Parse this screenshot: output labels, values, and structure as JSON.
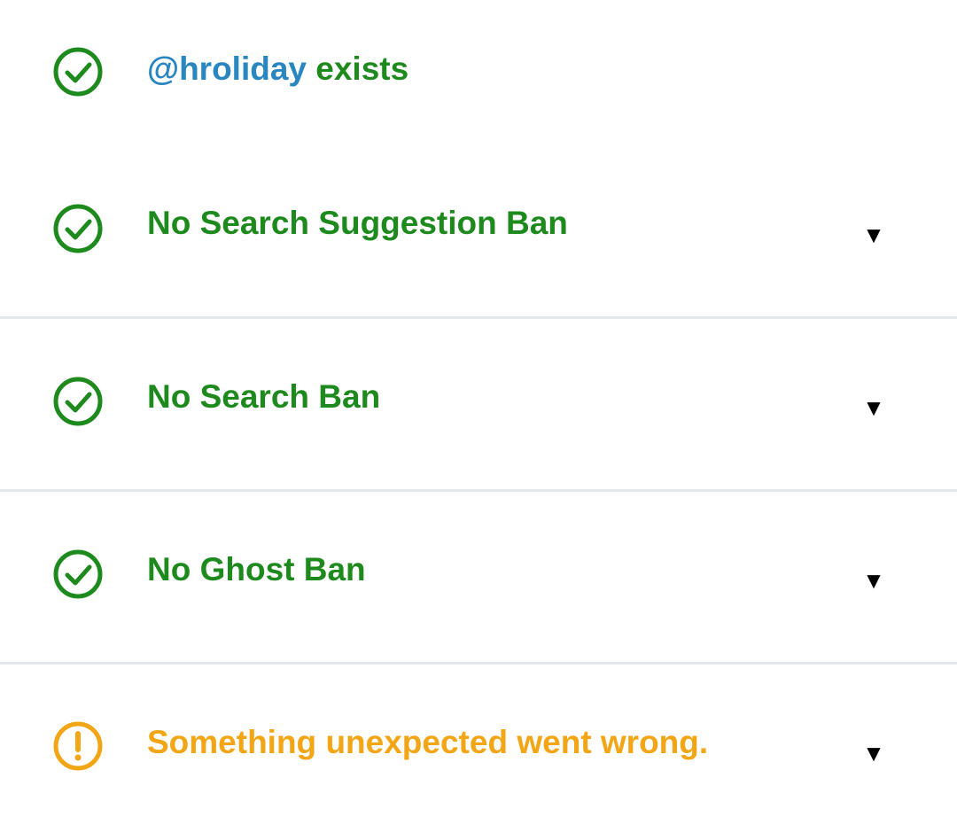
{
  "colors": {
    "success": "#1e8a1e",
    "warning": "#f2a515",
    "link": "#2a86bf",
    "divider": "#e3e7ea"
  },
  "results": [
    {
      "status": "success",
      "icon": "check-circle-icon",
      "handle": "@hroliday",
      "text": "exists",
      "expandable": false
    },
    {
      "status": "success",
      "icon": "check-circle-icon",
      "text": "No Search Suggestion Ban",
      "expandable": true,
      "toggle_glyph": "▼"
    },
    {
      "status": "success",
      "icon": "check-circle-icon",
      "text": "No Search Ban",
      "expandable": true,
      "toggle_glyph": "▼"
    },
    {
      "status": "success",
      "icon": "check-circle-icon",
      "text": "No Ghost Ban",
      "expandable": true,
      "toggle_glyph": "▼"
    },
    {
      "status": "warning",
      "icon": "exclamation-circle-icon",
      "text": "Something unexpected went wrong.",
      "expandable": true,
      "toggle_glyph": "▼"
    }
  ]
}
